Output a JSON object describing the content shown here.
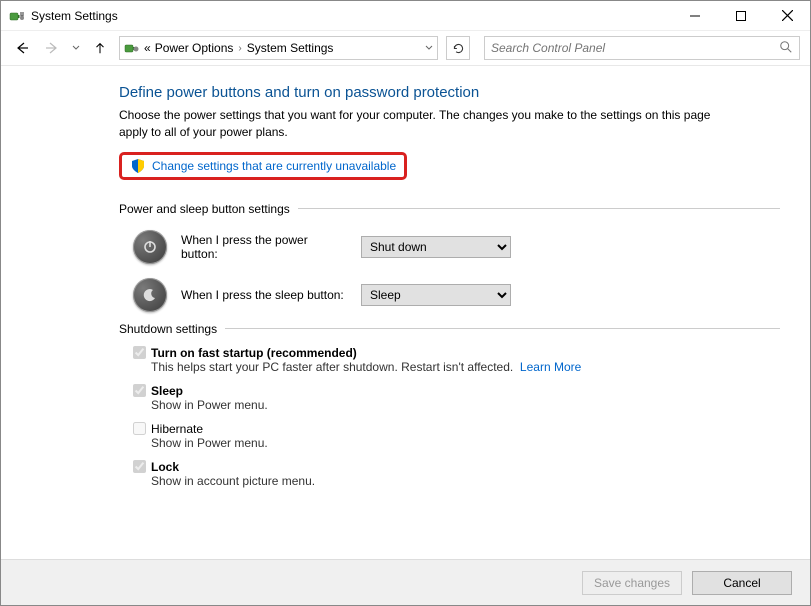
{
  "window": {
    "title": "System Settings"
  },
  "breadcrumb": {
    "prefix": "«",
    "parent": "Power Options",
    "current": "System Settings"
  },
  "search": {
    "placeholder": "Search Control Panel"
  },
  "main": {
    "heading": "Define power buttons and turn on password protection",
    "description": "Choose the power settings that you want for your computer. The changes you make to the settings on this page apply to all of your power plans.",
    "unlock_link": "Change settings that are currently unavailable",
    "section_power_sleep": "Power and sleep button settings",
    "power_label": "When I press the power button:",
    "power_value": "Shut down",
    "sleep_label": "When I press the sleep button:",
    "sleep_value": "Sleep",
    "section_shutdown": "Shutdown settings",
    "checks": [
      {
        "label": "Turn on fast startup (recommended)",
        "checked": true,
        "bold": true,
        "sub": "This helps start your PC faster after shutdown. Restart isn't affected.",
        "learn": "Learn More"
      },
      {
        "label": "Sleep",
        "checked": true,
        "bold": true,
        "sub": "Show in Power menu."
      },
      {
        "label": "Hibernate",
        "checked": false,
        "bold": false,
        "sub": "Show in Power menu."
      },
      {
        "label": "Lock",
        "checked": true,
        "bold": true,
        "sub": "Show in account picture menu."
      }
    ]
  },
  "footer": {
    "save": "Save changes",
    "cancel": "Cancel"
  }
}
